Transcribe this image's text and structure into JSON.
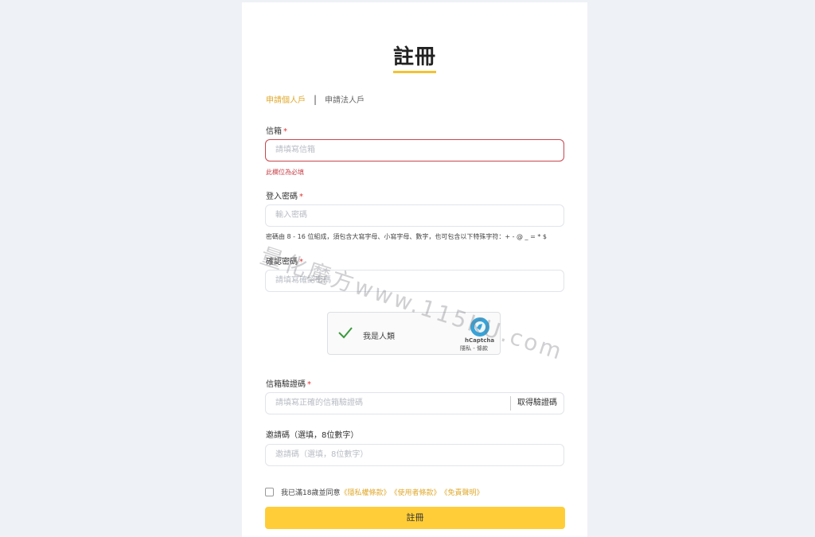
{
  "page": {
    "title": "註冊"
  },
  "tabs": {
    "individual": "申請個人戶",
    "separator": "|",
    "corporate": "申請法人戶"
  },
  "email": {
    "label": "信箱",
    "required_mark": "*",
    "placeholder": "請填寫信箱",
    "error": "此欄位為必填"
  },
  "password": {
    "label": "登入密碼",
    "required_mark": "*",
    "placeholder": "輸入密碼",
    "hint": "密碼由 8 - 16 位組成，須包含大寫字母、小寫字母、數字，也可包含以下特殊字符：+ - @ _ = * $"
  },
  "confirm_password": {
    "label": "確認密碼",
    "required_mark": "*",
    "placeholder": "請填寫確認密碼"
  },
  "captcha": {
    "label": "我是人類",
    "brand": "hCaptcha",
    "links": "隱私 - 條款"
  },
  "email_code": {
    "label": "信箱驗證碼",
    "required_mark": "*",
    "placeholder": "請填寫正確的信箱驗證碼",
    "button": "取得驗證碼"
  },
  "invite": {
    "label": "邀請碼（選填，8位數字）",
    "placeholder": "邀請碼（選填，8位數字）"
  },
  "agreement": {
    "prefix": "我已滿18歲並同意",
    "privacy": "《隱私權條款》",
    "terms": "《使用者條款》",
    "disclaimer": "《免責聲明》"
  },
  "submit": {
    "label": "註冊"
  },
  "watermark": "量化魔方www.115KU.com",
  "colors": {
    "accent": "#f2c231",
    "button": "#ffcd38",
    "error": "#c9464e",
    "link": "#e0a92c"
  }
}
